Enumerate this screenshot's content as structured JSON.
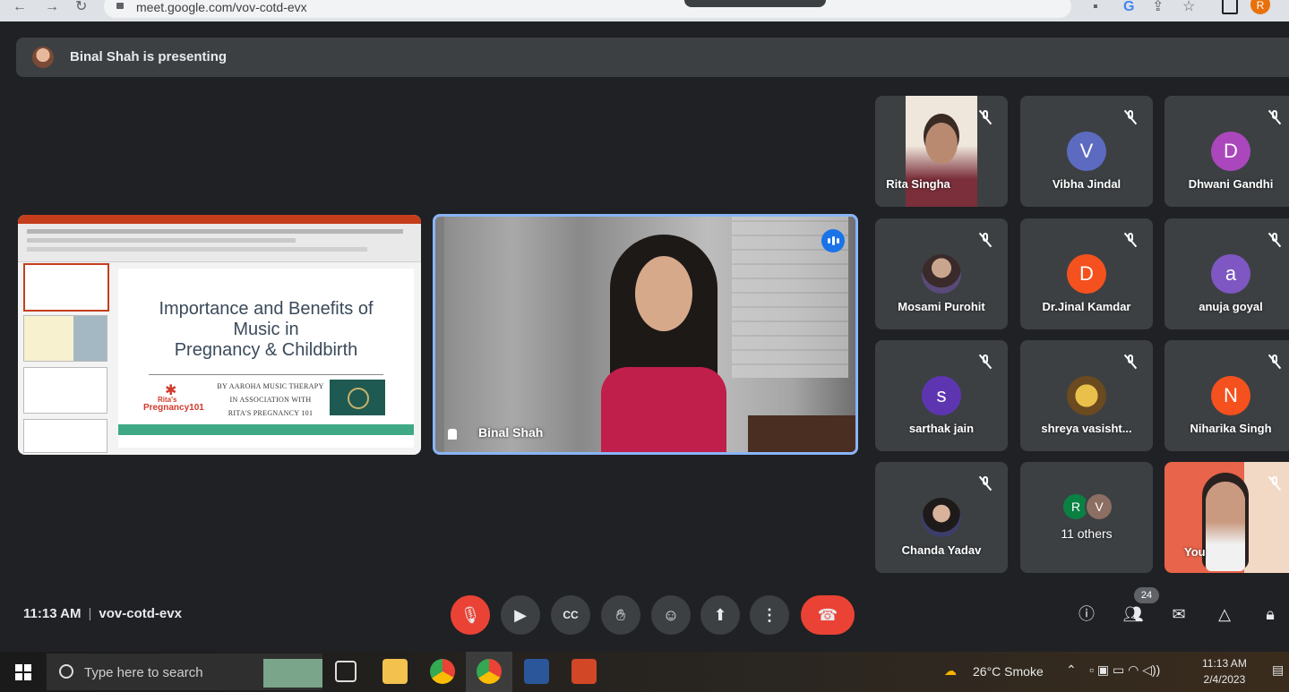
{
  "browser": {
    "url": "meet.google.com/vov-cotd-evx",
    "profile_initial": "R"
  },
  "presenting": {
    "text": "Binal Shah is presenting"
  },
  "slide": {
    "title_lines": [
      "Importance and Benefits of",
      "Music in",
      "Pregnancy & Childbirth"
    ],
    "credit_lines": [
      "BY AAROHA MUSIC THERAPY",
      "IN ASSOCIATION WITH",
      "RITA'S PREGNANCY 101"
    ],
    "logo_top": "Rita's",
    "logo_bottom": "Pregnancy101"
  },
  "speaker": {
    "name": "Binal Shah"
  },
  "participants": [
    {
      "name": "Rita Singha",
      "initial": "",
      "color": "",
      "photo": true
    },
    {
      "name": "Vibha Jindal",
      "initial": "V",
      "color": "#5c6bc0"
    },
    {
      "name": "Dhwani Gandhi",
      "initial": "D",
      "color": "#ab47bc"
    },
    {
      "name": "Mosami Purohit",
      "initial": "",
      "color": "",
      "photo": true
    },
    {
      "name": "Dr.Jinal Kamdar",
      "initial": "D",
      "color": "#f4511e"
    },
    {
      "name": "anuja goyal",
      "initial": "a",
      "color": "#7e57c2"
    },
    {
      "name": "sarthak jain",
      "initial": "s",
      "color": "#5e35b1"
    },
    {
      "name": "shreya vasisht...",
      "initial": "",
      "color": "",
      "photo": true
    },
    {
      "name": "Niharika Singh",
      "initial": "N",
      "color": "#f4511e"
    },
    {
      "name": "Chanda Yadav",
      "initial": "",
      "color": "",
      "photo": true
    },
    {
      "name": "11 others",
      "initial": "",
      "color": ""
    },
    {
      "name": "You",
      "initial": "",
      "color": "",
      "photo": true
    }
  ],
  "others_avatars": [
    {
      "initial": "R",
      "color": "#0b8043"
    },
    {
      "initial": "V",
      "color": "#8d6e63"
    }
  ],
  "meeting": {
    "time": "11:13 AM",
    "code": "vov-cotd-evx",
    "people_count": "24"
  },
  "taskbar": {
    "search_placeholder": "Type here to search",
    "weather": "26°C  Smoke",
    "clock_time": "11:13 AM",
    "clock_date": "2/4/2023"
  },
  "colors": {
    "background": "#202124",
    "tile": "#3c4043",
    "accent_blue": "#8ab4f8",
    "end_call_red": "#ea4335"
  }
}
